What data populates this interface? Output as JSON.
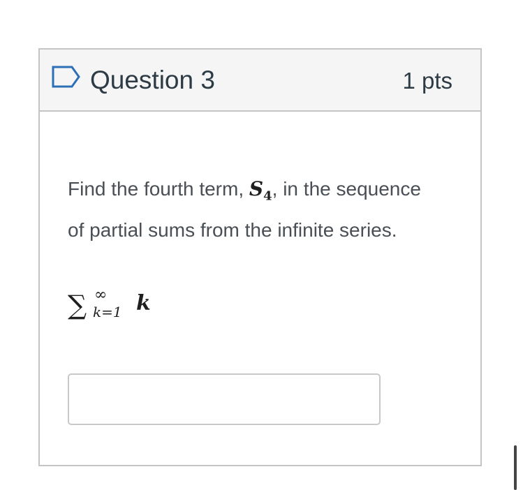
{
  "question": {
    "title": "Question 3",
    "points": "1 pts",
    "flag_icon": "flag-outline-icon",
    "prompt_before": "Find the fourth term, ",
    "prompt_symbol": "S",
    "prompt_subscript": "4",
    "prompt_after": ", in the sequence of partial sums from the infinite series.",
    "formula": {
      "sigma": "∑",
      "upper": "∞",
      "lower": "k=1",
      "term": "k"
    },
    "answer": {
      "value": "",
      "placeholder": ""
    }
  },
  "colors": {
    "header_bg": "#f5f5f5",
    "border": "#c4c4c4",
    "flag_stroke": "#2d6fb6",
    "text": "#2d3b45"
  }
}
